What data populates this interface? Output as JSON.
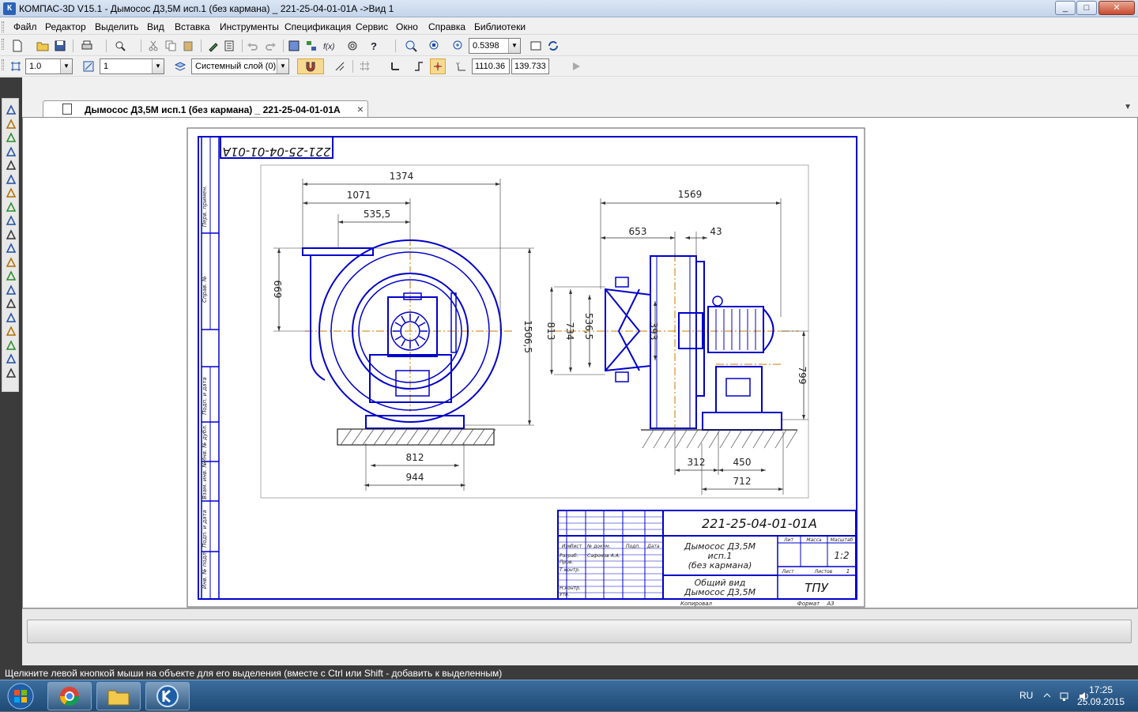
{
  "window": {
    "title": "КОМПАС-3D V15.1 - Дымосос Д3,5М исп.1 (без кармана) _ 221-25-04-01-01А ->Вид 1",
    "app_icon_letter": "К",
    "controls": {
      "minimize": "_",
      "maximize": "□",
      "close": "✕"
    }
  },
  "menu": [
    "Файл",
    "Редактор",
    "Выделить",
    "Вид",
    "Вставка",
    "Инструменты",
    "Спецификация",
    "Сервис",
    "Окно",
    "Справка",
    "Библиотеки"
  ],
  "toolbar": {
    "zoom_value": "0.5398"
  },
  "current_state": {
    "step_value": "1.0",
    "angle_value": "1",
    "layer_value": "Системный слой (0)",
    "coord_x": "1110.36",
    "coord_y": "139.733"
  },
  "document_tab": {
    "label": "Дымосос Д3,5М исп.1 (без кармана) _ 221-25-04-01-01А",
    "close": "×",
    "menu_arrow": "▼"
  },
  "drawing": {
    "designation": "221-25-04-01-01А",
    "front_view_dims": {
      "overall": "1374",
      "d1071": "1071",
      "d535": "535,5",
      "h669": "669",
      "h1506": "1506,5",
      "base812": "812",
      "base944": "944"
    },
    "side_view_dims": {
      "overall": "1569",
      "d653": "653",
      "d43": "43",
      "h813": "813",
      "h734": "734",
      "h536": "536,5",
      "h393": "393",
      "h799": "799",
      "b312": "312",
      "b450": "450",
      "b712": "712"
    },
    "title_block": {
      "name_line1": "Дымосос Д3,5М",
      "name_line2": "исп.1",
      "name_line3": "(без кармана)",
      "doc_line1": "Общий вид",
      "doc_line2": "Дымосос Д3,5М",
      "organization": "ТПУ",
      "scale": "1:2",
      "header_lit": "Лит",
      "header_mass": "Масса",
      "header_scale": "Масштаб",
      "sheet": "Лист",
      "sheets": "Листов",
      "sheets_count": "1",
      "copied": "Копировал",
      "format": "Формат",
      "format_value": "А3",
      "col_izm": "Изм",
      "col_list": "Лист",
      "col_ndoc": "№ докум.",
      "col_podp": "Подп.",
      "col_data": "Дата",
      "row_razrab": "Разраб.",
      "row_prov": "Пров.",
      "row_tkontr": "Т.контр.",
      "row_nkontr": "Н.контр.",
      "row_utv": "Утв.",
      "developer": "Сафонов А.А."
    },
    "margin_labels": [
      "Перв. примен.",
      "Справ. №",
      "Подп. и дата",
      "Инв. № дубл.",
      "Взам. инв. №",
      "Подп. и дата",
      "Инв. № подл."
    ]
  },
  "status_text": "Щелкните левой кнопкой мыши на объекте для его выделения (вместе с Ctrl или Shift - добавить к выделенным)",
  "taskbar": {
    "lang": "RU",
    "time": "17:25",
    "date": "25.09.2015"
  },
  "colors": {
    "accent": "#0000cc",
    "dim": "#333333",
    "axis": "#c87800",
    "frame": "#0000cc"
  }
}
